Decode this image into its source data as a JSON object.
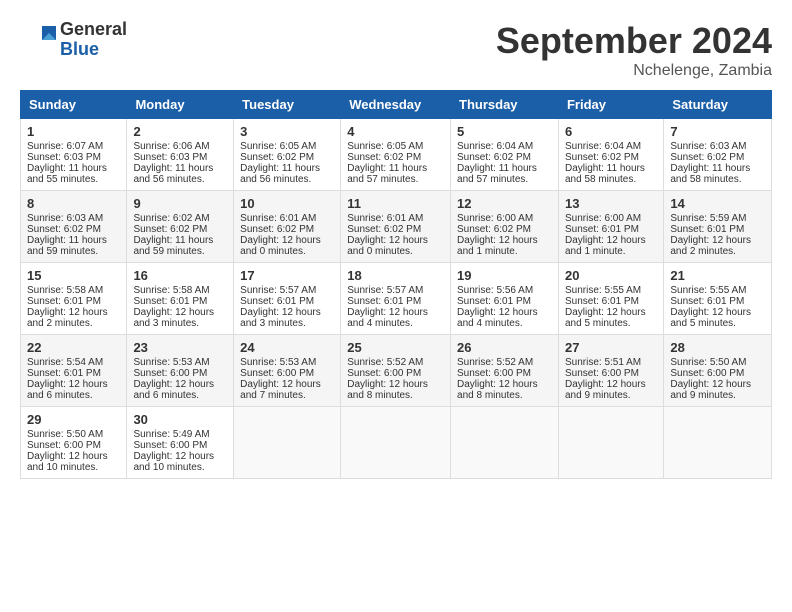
{
  "header": {
    "logo_line1": "General",
    "logo_line2": "Blue",
    "month": "September 2024",
    "location": "Nchelenge, Zambia"
  },
  "weekdays": [
    "Sunday",
    "Monday",
    "Tuesday",
    "Wednesday",
    "Thursday",
    "Friday",
    "Saturday"
  ],
  "weeks": [
    [
      {
        "day": "1",
        "info": "Sunrise: 6:07 AM\nSunset: 6:03 PM\nDaylight: 11 hours\nand 55 minutes."
      },
      {
        "day": "2",
        "info": "Sunrise: 6:06 AM\nSunset: 6:03 PM\nDaylight: 11 hours\nand 56 minutes."
      },
      {
        "day": "3",
        "info": "Sunrise: 6:05 AM\nSunset: 6:02 PM\nDaylight: 11 hours\nand 56 minutes."
      },
      {
        "day": "4",
        "info": "Sunrise: 6:05 AM\nSunset: 6:02 PM\nDaylight: 11 hours\nand 57 minutes."
      },
      {
        "day": "5",
        "info": "Sunrise: 6:04 AM\nSunset: 6:02 PM\nDaylight: 11 hours\nand 57 minutes."
      },
      {
        "day": "6",
        "info": "Sunrise: 6:04 AM\nSunset: 6:02 PM\nDaylight: 11 hours\nand 58 minutes."
      },
      {
        "day": "7",
        "info": "Sunrise: 6:03 AM\nSunset: 6:02 PM\nDaylight: 11 hours\nand 58 minutes."
      }
    ],
    [
      {
        "day": "8",
        "info": "Sunrise: 6:03 AM\nSunset: 6:02 PM\nDaylight: 11 hours\nand 59 minutes."
      },
      {
        "day": "9",
        "info": "Sunrise: 6:02 AM\nSunset: 6:02 PM\nDaylight: 11 hours\nand 59 minutes."
      },
      {
        "day": "10",
        "info": "Sunrise: 6:01 AM\nSunset: 6:02 PM\nDaylight: 12 hours\nand 0 minutes."
      },
      {
        "day": "11",
        "info": "Sunrise: 6:01 AM\nSunset: 6:02 PM\nDaylight: 12 hours\nand 0 minutes."
      },
      {
        "day": "12",
        "info": "Sunrise: 6:00 AM\nSunset: 6:02 PM\nDaylight: 12 hours\nand 1 minute."
      },
      {
        "day": "13",
        "info": "Sunrise: 6:00 AM\nSunset: 6:01 PM\nDaylight: 12 hours\nand 1 minute."
      },
      {
        "day": "14",
        "info": "Sunrise: 5:59 AM\nSunset: 6:01 PM\nDaylight: 12 hours\nand 2 minutes."
      }
    ],
    [
      {
        "day": "15",
        "info": "Sunrise: 5:58 AM\nSunset: 6:01 PM\nDaylight: 12 hours\nand 2 minutes."
      },
      {
        "day": "16",
        "info": "Sunrise: 5:58 AM\nSunset: 6:01 PM\nDaylight: 12 hours\nand 3 minutes."
      },
      {
        "day": "17",
        "info": "Sunrise: 5:57 AM\nSunset: 6:01 PM\nDaylight: 12 hours\nand 3 minutes."
      },
      {
        "day": "18",
        "info": "Sunrise: 5:57 AM\nSunset: 6:01 PM\nDaylight: 12 hours\nand 4 minutes."
      },
      {
        "day": "19",
        "info": "Sunrise: 5:56 AM\nSunset: 6:01 PM\nDaylight: 12 hours\nand 4 minutes."
      },
      {
        "day": "20",
        "info": "Sunrise: 5:55 AM\nSunset: 6:01 PM\nDaylight: 12 hours\nand 5 minutes."
      },
      {
        "day": "21",
        "info": "Sunrise: 5:55 AM\nSunset: 6:01 PM\nDaylight: 12 hours\nand 5 minutes."
      }
    ],
    [
      {
        "day": "22",
        "info": "Sunrise: 5:54 AM\nSunset: 6:01 PM\nDaylight: 12 hours\nand 6 minutes."
      },
      {
        "day": "23",
        "info": "Sunrise: 5:53 AM\nSunset: 6:00 PM\nDaylight: 12 hours\nand 6 minutes."
      },
      {
        "day": "24",
        "info": "Sunrise: 5:53 AM\nSunset: 6:00 PM\nDaylight: 12 hours\nand 7 minutes."
      },
      {
        "day": "25",
        "info": "Sunrise: 5:52 AM\nSunset: 6:00 PM\nDaylight: 12 hours\nand 8 minutes."
      },
      {
        "day": "26",
        "info": "Sunrise: 5:52 AM\nSunset: 6:00 PM\nDaylight: 12 hours\nand 8 minutes."
      },
      {
        "day": "27",
        "info": "Sunrise: 5:51 AM\nSunset: 6:00 PM\nDaylight: 12 hours\nand 9 minutes."
      },
      {
        "day": "28",
        "info": "Sunrise: 5:50 AM\nSunset: 6:00 PM\nDaylight: 12 hours\nand 9 minutes."
      }
    ],
    [
      {
        "day": "29",
        "info": "Sunrise: 5:50 AM\nSunset: 6:00 PM\nDaylight: 12 hours\nand 10 minutes."
      },
      {
        "day": "30",
        "info": "Sunrise: 5:49 AM\nSunset: 6:00 PM\nDaylight: 12 hours\nand 10 minutes."
      },
      {
        "day": "",
        "info": ""
      },
      {
        "day": "",
        "info": ""
      },
      {
        "day": "",
        "info": ""
      },
      {
        "day": "",
        "info": ""
      },
      {
        "day": "",
        "info": ""
      }
    ]
  ]
}
